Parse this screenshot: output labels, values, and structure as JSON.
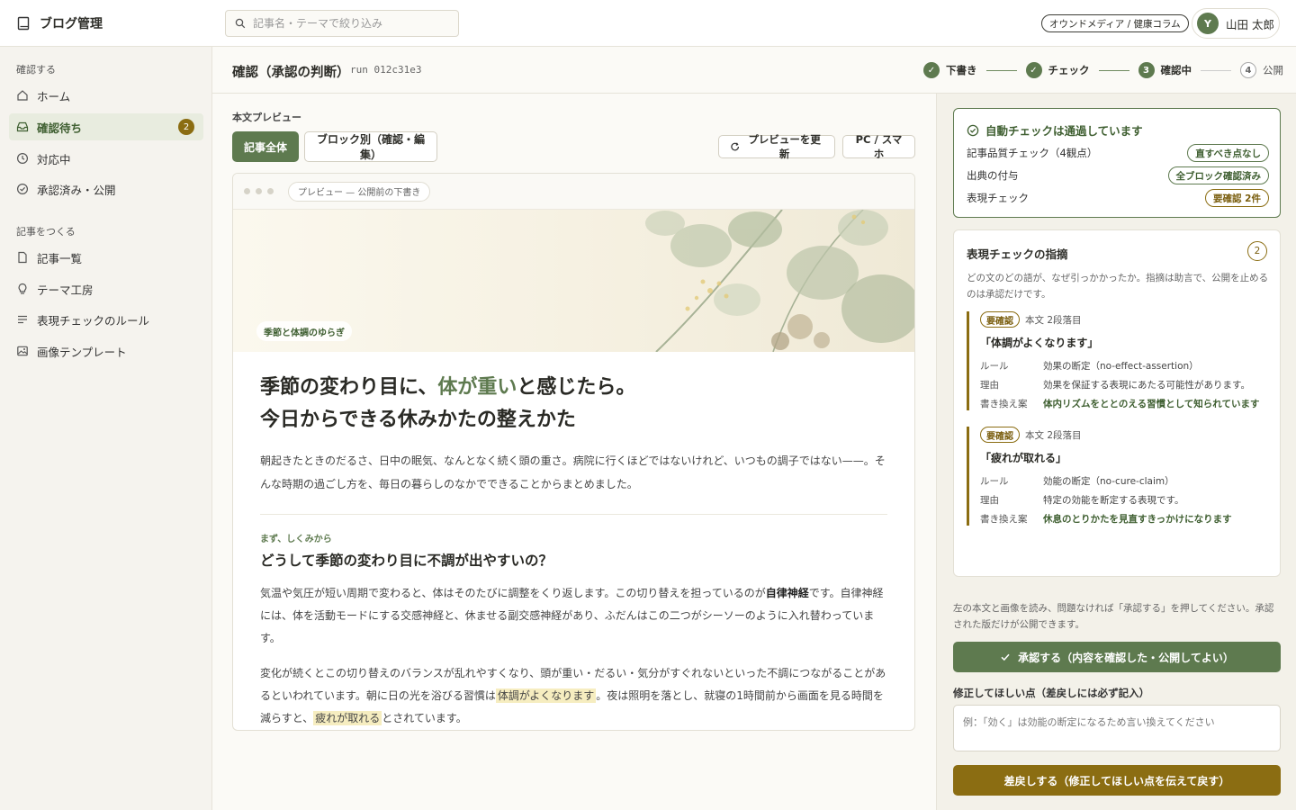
{
  "app": {
    "title": "ブログ管理"
  },
  "search": {
    "placeholder": "記事名・テーマで絞り込み"
  },
  "header": {
    "org": "オウンドメディア / 健康コラム",
    "user_initial": "Y",
    "user_name": "山田 太郎"
  },
  "sidebar": {
    "section1": "確認する",
    "section2": "記事をつくる",
    "items": [
      {
        "label": "ホーム"
      },
      {
        "label": "確認待ち",
        "badge": "2"
      },
      {
        "label": "対応中"
      },
      {
        "label": "承認済み・公開"
      },
      {
        "label": "記事一覧"
      },
      {
        "label": "テーマ工房"
      },
      {
        "label": "表現チェックのルール"
      },
      {
        "label": "画像テンプレート"
      }
    ]
  },
  "page": {
    "title": "確認（承認の判断）",
    "run": "run 012c31e3"
  },
  "steps": [
    {
      "label": "下書き",
      "state": "done"
    },
    {
      "label": "チェック",
      "state": "done"
    },
    {
      "label": "確認中",
      "num": "3",
      "state": "current"
    },
    {
      "label": "公開",
      "num": "4",
      "state": "todo"
    }
  ],
  "preview": {
    "label": "本文プレビュー",
    "tab_all": "記事全体",
    "tab_blocks": "ブロック別（確認・編集）",
    "refresh": "プレビューを更新",
    "device": "PC / スマホ",
    "url": "プレビュー — 公開前の下書き"
  },
  "article": {
    "tag": "季節と体調のゆらぎ",
    "h1_pre": "季節の変わり目に、",
    "h1_accent": "体が重い",
    "h1_post": "と感じたら。",
    "h1_line2": "今日からできる休みかたの整えかた",
    "lead": "朝起きたときのだるさ、日中の眠気、なんとなく続く頭の重さ。病院に行くほどではないけれど、いつもの調子ではない——。そんな時期の過ごし方を、毎日の暮らしのなかでできることからまとめました。",
    "kicker": "まず、しくみから",
    "h2": "どうして季節の変わり目に不調が出やすいの？",
    "p1_a": "気温や気圧が短い周期で変わると、体はそのたびに調整をくり返します。この切り替えを担っているのが",
    "p1_bold": "自律神経",
    "p1_b": "です。自律神経には、体を活動モードにする交感神経と、休ませる副交感神経があり、ふだんはこの二つがシーソーのように入れ替わっています。",
    "p2_a": "変化が続くとこの切り替えのバランスが乱れやすくなり、頭が重い・だるい・気分がすぐれないといった不調につながることがあるといわれています。朝に日の光を浴びる習慣は",
    "p2_hl1": "体調がよくなります",
    "p2_b": "。夜は照明を落とし、就寝の1時間前から画面を見る時間を減らすと、",
    "p2_hl2": "疲れが取れる",
    "p2_c": "とされています。"
  },
  "auto_check": {
    "title": "自動チェックは通過しています",
    "rows": [
      {
        "label": "記事品質チェック（4観点）",
        "status": "直すべき点なし",
        "tone": "green"
      },
      {
        "label": "出典の付与",
        "status": "全ブロック確認済み",
        "tone": "green"
      },
      {
        "label": "表現チェック",
        "status": "要確認 2件",
        "tone": "gold"
      }
    ]
  },
  "findings": {
    "title": "表現チェックの指摘",
    "count": "2",
    "desc": "どの文のどの語が、なぜ引っかかったか。指摘は助言で、公開を止めるのは承認だけです。",
    "key_rule": "ルール",
    "key_reason": "理由",
    "key_rewrite": "書き換え案",
    "items": [
      {
        "tag": "要確認",
        "loc": "本文 2段落目",
        "quote": "「体調がよくなります」",
        "rule": "効果の断定（no-effect-assertion）",
        "reason": "効果を保証する表現にあたる可能性があります。",
        "rewrite": "体内リズムをととのえる習慣として知られています"
      },
      {
        "tag": "要確認",
        "loc": "本文 2段落目",
        "quote": "「疲れが取れる」",
        "rule": "効能の断定（no-cure-claim）",
        "reason": "特定の効能を断定する表現です。",
        "rewrite": "休息のとりかたを見直すきっかけになります"
      }
    ]
  },
  "decision": {
    "note": "左の本文と画像を読み、問題なければ「承認する」を押してください。承認された版だけが公開できます。",
    "approve": "承認する（内容を確認した・公開してよい）",
    "fix_label": "修正してほしい点（差戻しには必ず記入）",
    "fix_placeholder": "例：「効く」は効能の断定になるため言い換えてください",
    "reject": "差戻しする（修正してほしい点を伝えて戻す）"
  },
  "colors": {
    "accent": "#5e7a4f",
    "warning": "#8b6d12"
  }
}
